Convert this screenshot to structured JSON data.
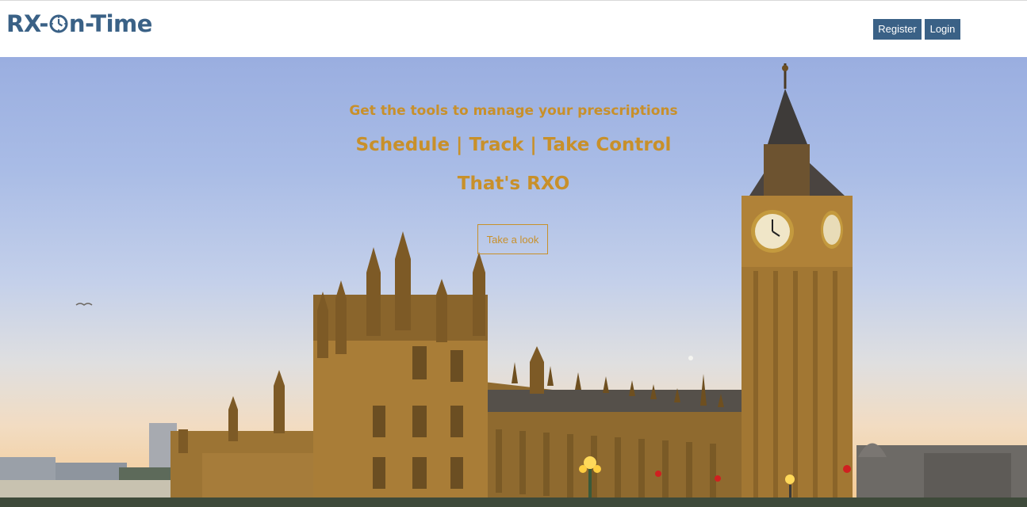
{
  "brand": {
    "name_prefix": "RX-",
    "name_suffix": "n-Time"
  },
  "nav": {
    "register_label": "Register",
    "login_label": "Login"
  },
  "hero": {
    "line1": "Get the tools to manage your prescriptions",
    "line2": "Schedule | Track | Take Control",
    "line3": "That's RXO",
    "cta_label": "Take a look"
  },
  "colors": {
    "brand": "#3a6186",
    "accent": "#c8902a"
  },
  "icons": {
    "logo_clock": "clock-icon"
  }
}
